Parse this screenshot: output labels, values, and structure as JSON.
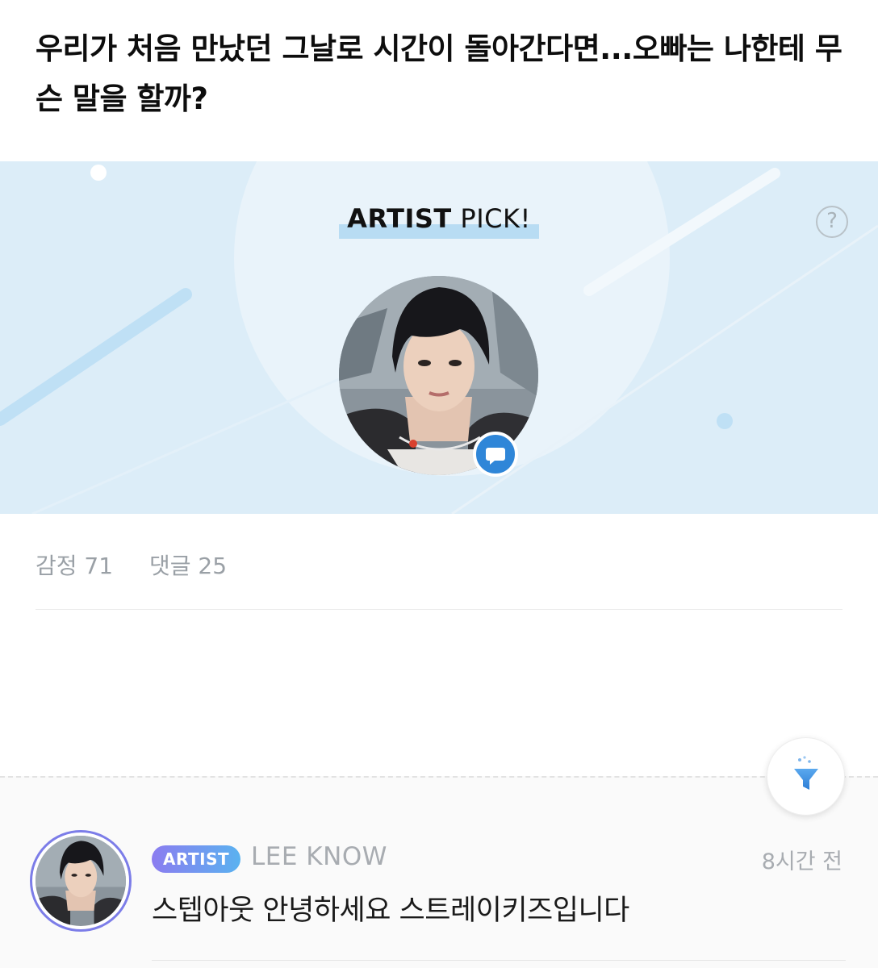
{
  "post": {
    "title": "우리가 처음 만났던 그날로 시간이 돌아간다면...오빠는 나한테 무슨 말을 할까?"
  },
  "artist_pick": {
    "label_strong": "ARTIST",
    "label_rest": " PICK!",
    "help_symbol": "?",
    "badge_icon": "chat-bubble-icon"
  },
  "stats": {
    "emotion": "감정 71",
    "comments": "댓글 25"
  },
  "comment": {
    "badge": "ARTIST",
    "author": "LEE KNOW",
    "time": "8시간 전",
    "text": "스텝아웃 안녕하세요 스트레이키즈입니다"
  },
  "colors": {
    "banner_bg": "#dcedf8",
    "accent_blue": "#2f86d8",
    "badge_gradient_start": "#8b7cf0",
    "badge_gradient_end": "#5ab2f0"
  },
  "icons": {
    "filter": "filter-funnel-icon",
    "help": "question-icon"
  }
}
